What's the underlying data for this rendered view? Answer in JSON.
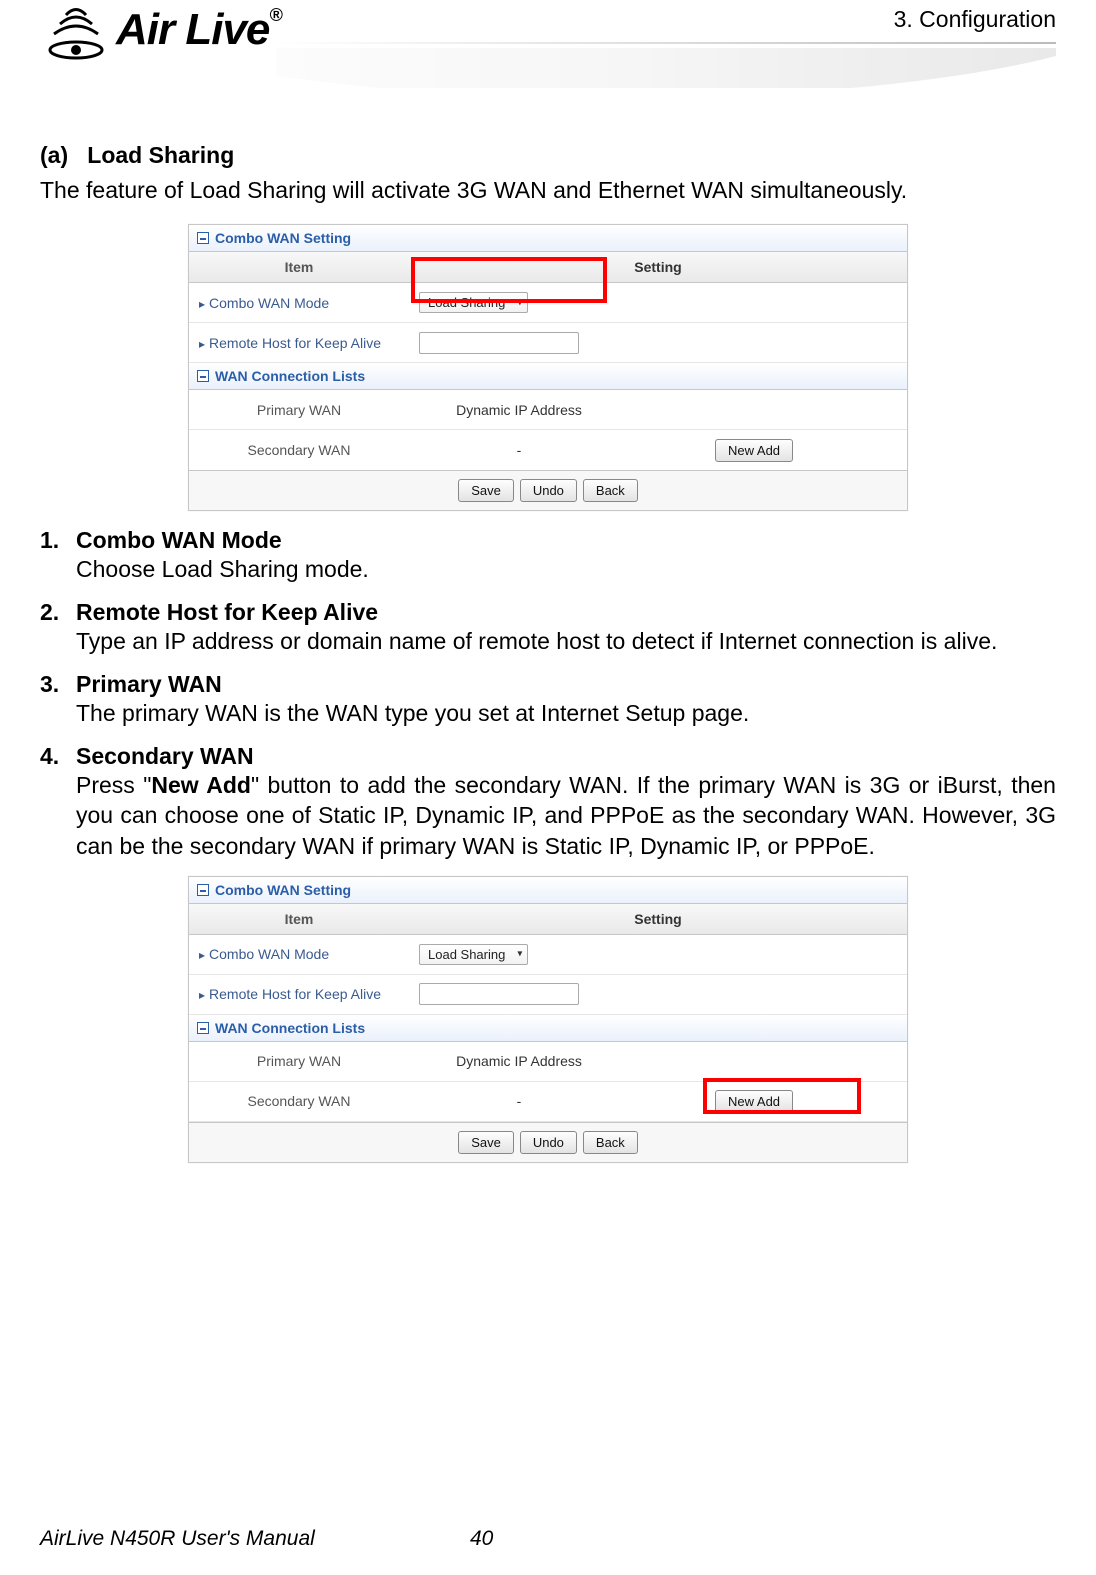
{
  "header": {
    "logo_text": "Air Live",
    "logo_reg": "®",
    "chapter": "3.  Configuration"
  },
  "section": {
    "label": "(a)",
    "title": "Load Sharing",
    "intro": "The feature of Load Sharing will activate 3G WAN and Ethernet WAN simultaneously."
  },
  "screenshot": {
    "panel1_title": "Combo WAN Setting",
    "head_item": "Item",
    "head_setting": "Setting",
    "row1_label": "Combo WAN Mode",
    "row1_value": "Load Sharing",
    "row2_label": "Remote Host for Keep Alive",
    "panel2_title": "WAN Connection Lists",
    "primary_label": "Primary WAN",
    "primary_value": "Dynamic IP Address",
    "secondary_label": "Secondary WAN",
    "secondary_value": "-",
    "new_add": "New Add",
    "save": "Save",
    "undo": "Undo",
    "back": "Back"
  },
  "items": {
    "n1": "1.",
    "t1": "Combo WAN Mode",
    "d1": "Choose Load Sharing mode.",
    "n2": "2.",
    "t2": "Remote Host for Keep Alive",
    "d2": "Type an IP address or domain name of remote host to detect if Internet connection is alive.",
    "n3": "3.",
    "t3": "Primary WAN",
    "d3": "The primary WAN is the WAN type you set at Internet Setup page.",
    "n4": "4.",
    "t4": "Secondary WAN",
    "d4a": "Press \"",
    "d4b": "New Add",
    "d4c": "\" button to add the secondary WAN. If the primary WAN is 3G or iBurst, then you can choose one of Static IP, Dynamic IP, and PPPoE as the secondary WAN. However, 3G can be the secondary WAN if primary WAN is Static IP, Dynamic IP, or PPPoE."
  },
  "footer": {
    "manual": "AirLive N450R User's Manual",
    "page": "40"
  }
}
